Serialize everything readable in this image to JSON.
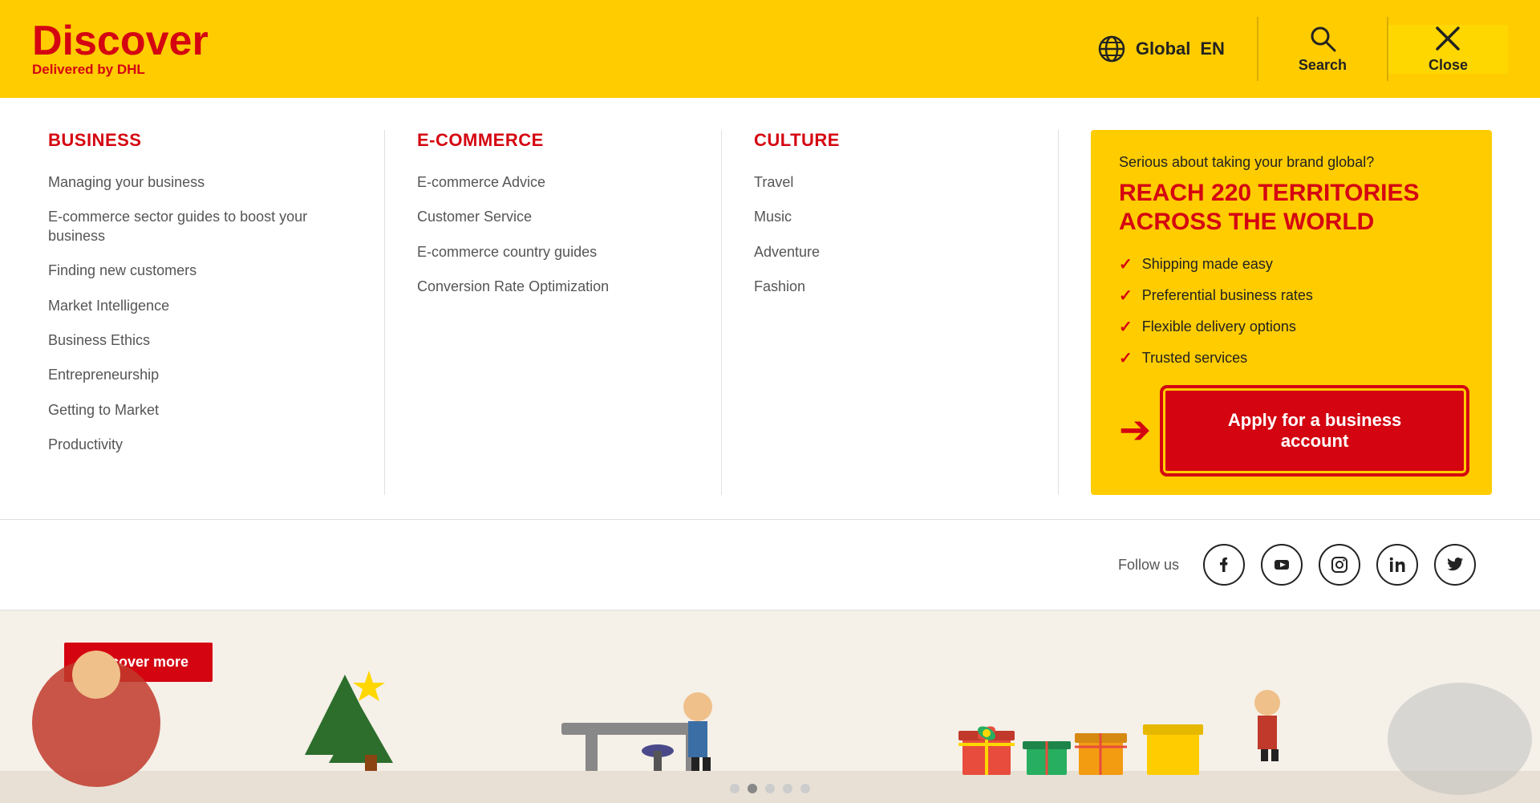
{
  "header": {
    "logo_discover": "Discover",
    "logo_subtitle": "Delivered by",
    "logo_dhl": "DHL",
    "region": "Global",
    "language": "EN",
    "search_label": "Search",
    "close_label": "Close"
  },
  "menu": {
    "columns": [
      {
        "title": "BUSINESS",
        "items": [
          "Managing your business",
          "E-commerce sector guides to boost your business",
          "Finding new customers",
          "Market Intelligence",
          "Business Ethics",
          "Entrepreneurship",
          "Getting to Market",
          "Productivity"
        ]
      },
      {
        "title": "E-COMMERCE",
        "items": [
          "E-commerce Advice",
          "Customer Service",
          "E-commerce country guides",
          "Conversion Rate Optimization"
        ]
      },
      {
        "title": "CULTURE",
        "items": [
          "Travel",
          "Music",
          "Adventure",
          "Fashion"
        ]
      }
    ]
  },
  "promo": {
    "subtitle": "Serious about taking your brand global?",
    "title": "REACH 220 TERRITORIES ACROSS THE WORLD",
    "features": [
      "Shipping made easy",
      "Preferential business rates",
      "Flexible delivery options",
      "Trusted services"
    ],
    "cta_label": "Apply for a business account"
  },
  "social": {
    "label": "Follow us",
    "platforms": [
      "facebook",
      "youtube",
      "instagram",
      "linkedin",
      "twitter"
    ]
  },
  "pagination": {
    "dots": [
      false,
      true,
      false,
      false,
      false
    ]
  }
}
